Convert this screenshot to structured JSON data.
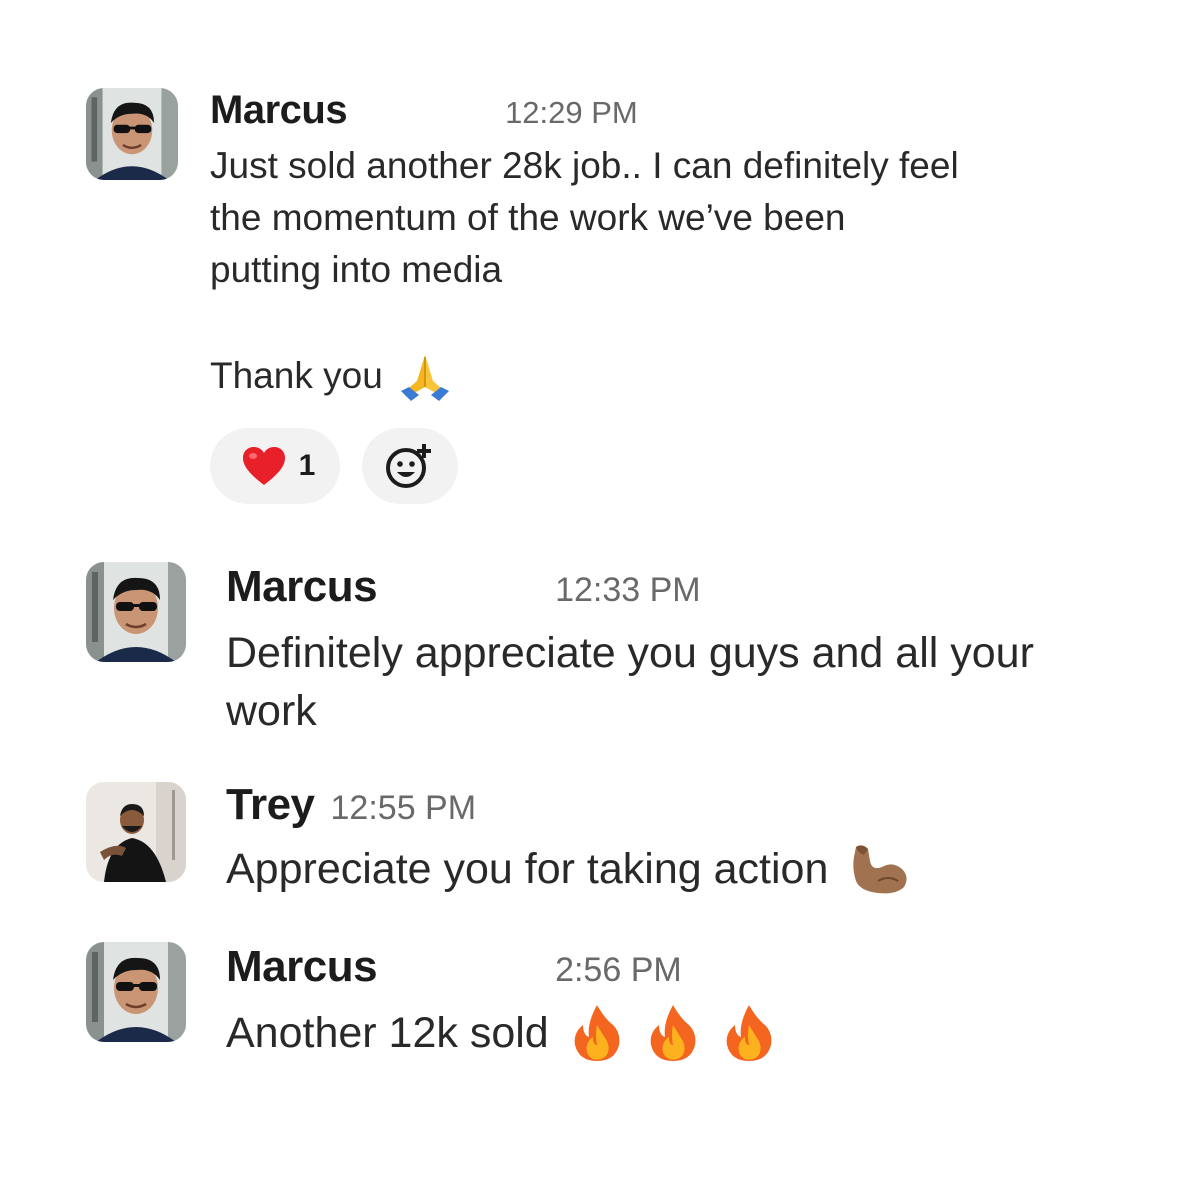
{
  "messages": [
    {
      "author": "Marcus",
      "time": "12:29 PM",
      "lines": [
        "Just sold another 28k job.. I can definitely feel",
        "the momentum of the work we’ve been",
        "putting into media"
      ],
      "thanks": "Thank you",
      "emoji": "folded-hands",
      "reactions": [
        {
          "emoji": "red-heart",
          "count": "1"
        }
      ]
    },
    {
      "author": "Marcus",
      "time": "12:33 PM",
      "lines": [
        "Definitely appreciate you guys and all your",
        "work"
      ]
    },
    {
      "author": "Trey",
      "time": "12:55 PM",
      "lines": [
        "Appreciate you for taking action"
      ],
      "emoji": "flexed-biceps"
    },
    {
      "author": "Marcus",
      "time": "2:56 PM",
      "lines": [
        "Another 12k sold"
      ],
      "emoji": "fire"
    }
  ],
  "colors": {
    "name": "#1d1c1d",
    "time": "#696969",
    "reaction_bg": "#f2f2f2"
  }
}
